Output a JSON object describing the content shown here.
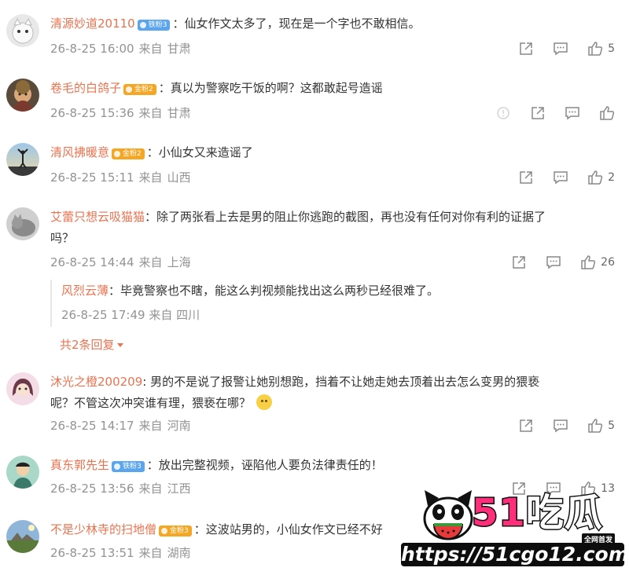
{
  "colors": {
    "username": "#eb7350",
    "meta": "#939393",
    "text": "#333333",
    "badge_blue": "#5aa5ed",
    "badge_gold": "#f5a623"
  },
  "actions": {
    "share_icon": "share-icon",
    "comment_icon": "comment-icon",
    "like_icon": "thumbs-up-icon",
    "report_icon": "report-icon"
  },
  "comments": [
    {
      "user": "清源妙道20110",
      "badge": "铁粉3",
      "colon": "：",
      "text": "仙女作文太多了，现在是一个字也不敢相信。",
      "date": "26-8-25 16:00",
      "source": "来自",
      "location": "甘肃",
      "likes": "5"
    },
    {
      "user": "卷毛的白鸽子",
      "badge": "金粉2",
      "colon": "：",
      "text": "真以为警察吃干饭的啊？这都敢起号造谣",
      "date": "26-8-25 15:36",
      "source": "来自",
      "location": "甘肃",
      "likes": ""
    },
    {
      "user": "清风拂暖意",
      "badge": "金粉2",
      "colon": "：",
      "text": "小仙女又来造谣了",
      "date": "26-8-25 15:11",
      "source": "来自",
      "location": "山西",
      "likes": "2"
    },
    {
      "user": "艾蕾只想云吸猫猫",
      "colon": "：",
      "text": "除了两张看上去是男的阻止你逃跑的截图，再也没有任何对你有利的证据了",
      "text2": "吗？",
      "date": "26-8-25 14:44",
      "source": "来自",
      "location": "上海",
      "likes": "26",
      "reply": {
        "user": "风烈云薄",
        "colon": "：",
        "text": "毕竟警察也不瞎，能这么判视频能找出这么两秒已经很难了。",
        "date": "26-8-25 17:49",
        "source": "来自",
        "location": "四川"
      },
      "more_replies": "共2条回复"
    },
    {
      "user": "沐光之橙200209",
      "colon": ":",
      "text": "男的不是说了报警让她别想跑，挡着不让她走她去顶着出去怎么变男的猥亵",
      "text2": "呢？不管这次冲突谁有理，猥亵在哪？",
      "date": "26-8-25 14:17",
      "source": "来自",
      "location": "河南",
      "likes": "5"
    },
    {
      "user": "真东郭先生",
      "badge": "铁粉3",
      "colon": "：",
      "text": "放出完整视频，诬陷他人要负法律责任的！",
      "date": "26-8-25 13:56",
      "source": "来自",
      "location": "江西",
      "likes": "13"
    },
    {
      "user": "不是少林寺的扫地僧",
      "badge": "金粉3",
      "colon": "：",
      "text": "这波站男的，小仙女作文已经不好",
      "date": "26-8-25 13:51",
      "source": "来自",
      "location": "湖南",
      "likes": ""
    }
  ],
  "watermark": {
    "title_num": "51",
    "title_text": "吃瓜",
    "tag": "全网首发",
    "url": "https://51cgo12.com"
  }
}
